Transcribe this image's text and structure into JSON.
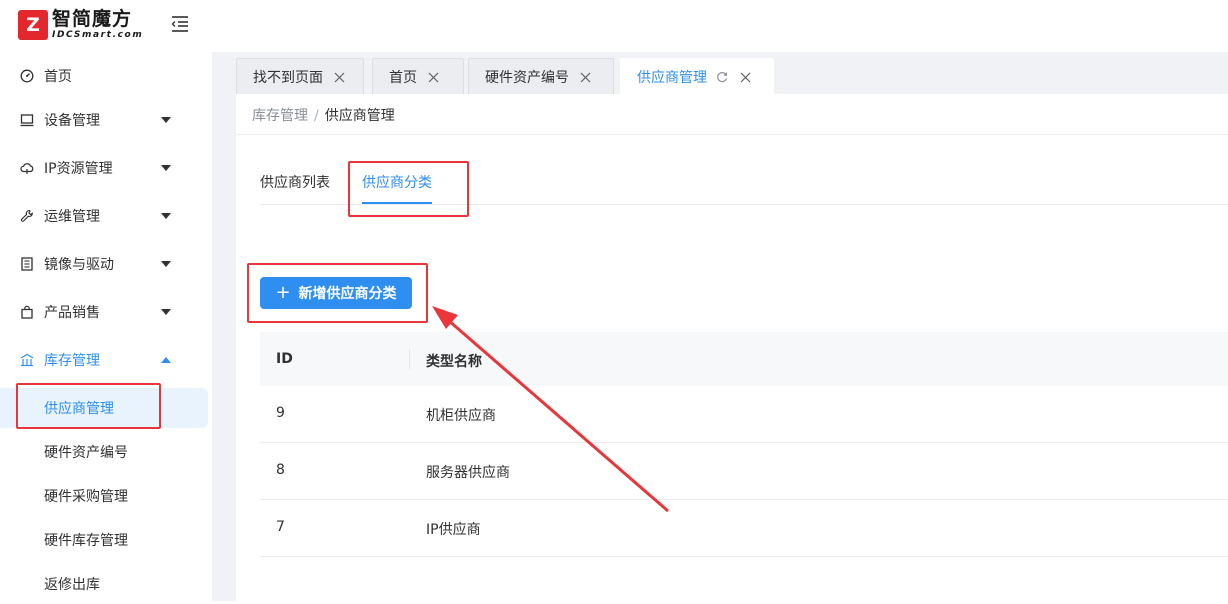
{
  "logo": {
    "mark": "Z",
    "name_cn": "智简魔方",
    "name_en": "IDCSmart.com"
  },
  "sidebar": {
    "items": [
      {
        "label": "首页",
        "icon": "dashboard-icon",
        "expandable": false
      },
      {
        "label": "设备管理",
        "icon": "monitor-icon",
        "expandable": true
      },
      {
        "label": "IP资源管理",
        "icon": "cloud-icon",
        "expandable": true
      },
      {
        "label": "运维管理",
        "icon": "wrench-icon",
        "expandable": true
      },
      {
        "label": "镜像与驱动",
        "icon": "disk-icon",
        "expandable": true
      },
      {
        "label": "产品销售",
        "icon": "bag-icon",
        "expandable": true
      },
      {
        "label": "库存管理",
        "icon": "warehouse-icon",
        "expandable": true,
        "open": true
      }
    ],
    "sub_items": [
      {
        "label": "供应商管理",
        "active": true
      },
      {
        "label": "硬件资产编号"
      },
      {
        "label": "硬件采购管理"
      },
      {
        "label": "硬件库存管理"
      },
      {
        "label": "返修出库"
      }
    ]
  },
  "tabs": [
    {
      "label": "找不到页面"
    },
    {
      "label": "首页"
    },
    {
      "label": "硬件资产编号"
    },
    {
      "label": "供应商管理",
      "active": true
    }
  ],
  "breadcrumb": {
    "parent": "库存管理",
    "separator": "/",
    "current": "供应商管理"
  },
  "sub_tabs": [
    {
      "label": "供应商列表"
    },
    {
      "label": "供应商分类",
      "active": true
    }
  ],
  "add_button": {
    "icon": "+",
    "label": "新增供应商分类"
  },
  "table": {
    "columns": [
      "ID",
      "类型名称"
    ],
    "rows": [
      {
        "id": "9",
        "name": "机柜供应商"
      },
      {
        "id": "8",
        "name": "服务器供应商"
      },
      {
        "id": "7",
        "name": "IP供应商"
      }
    ]
  },
  "colors": {
    "primary": "#2e8ff0",
    "annotation": "#e8363a",
    "logo_red": "#e4262d"
  }
}
